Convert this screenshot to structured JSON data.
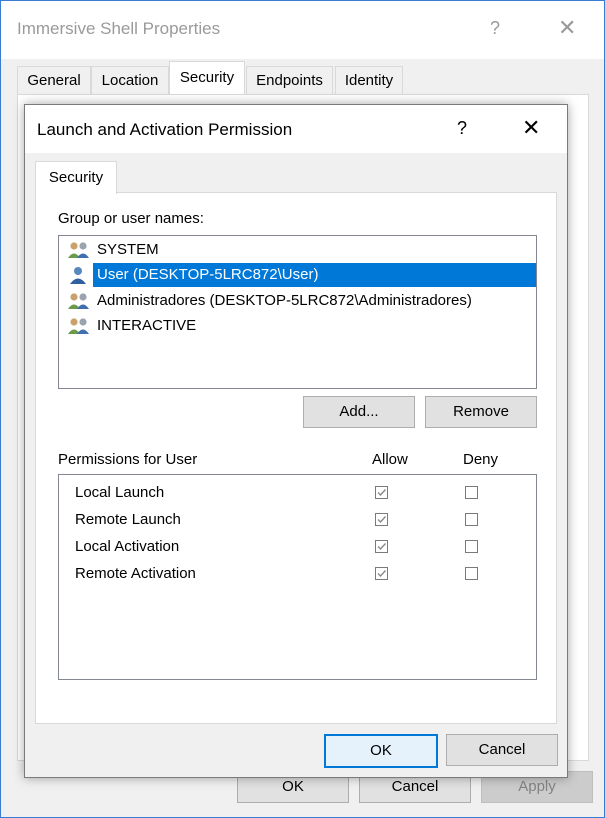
{
  "parent": {
    "title": "Immersive Shell Properties",
    "help_glyph": "?",
    "close_glyph": "✕",
    "tabs": [
      {
        "label": "General"
      },
      {
        "label": "Location"
      },
      {
        "label": "Security"
      },
      {
        "label": "Endpoints"
      },
      {
        "label": "Identity"
      }
    ],
    "active_tab": "Security",
    "buttons": {
      "ok": "OK",
      "cancel": "Cancel",
      "apply": "Apply"
    }
  },
  "dialog": {
    "title": "Launch and Activation Permission",
    "help_glyph": "?",
    "close_glyph": "✕",
    "tab": "Security",
    "group_label": "Group or user names:",
    "users": [
      {
        "label": "SYSTEM",
        "icon": "group-users-icon",
        "selected": false
      },
      {
        "label": "User (DESKTOP-5LRC872\\User)",
        "icon": "user-icon",
        "selected": true
      },
      {
        "label": "Administradores (DESKTOP-5LRC872\\Administradores)",
        "icon": "group-users-icon",
        "selected": false
      },
      {
        "label": "INTERACTIVE",
        "icon": "group-users-icon",
        "selected": false
      }
    ],
    "add_button": "Add...",
    "remove_button": "Remove",
    "permissions_label": "Permissions for User",
    "allow_label": "Allow",
    "deny_label": "Deny",
    "permissions": [
      {
        "name": "Local Launch",
        "allow": true,
        "deny": false
      },
      {
        "name": "Remote Launch",
        "allow": true,
        "deny": false
      },
      {
        "name": "Local Activation",
        "allow": true,
        "deny": false
      },
      {
        "name": "Remote Activation",
        "allow": true,
        "deny": false
      }
    ],
    "ok_button": "OK",
    "cancel_button": "Cancel"
  },
  "colors": {
    "selection": "#0078d7",
    "checkmark_disabled": "#8a8a8a"
  }
}
